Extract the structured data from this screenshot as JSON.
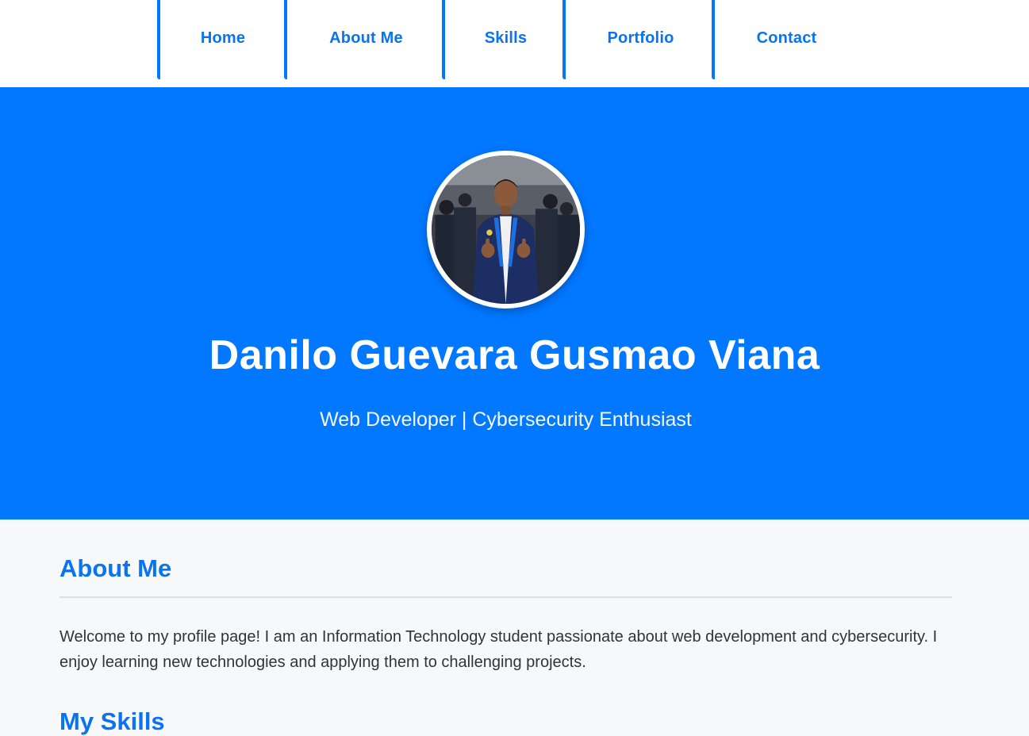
{
  "nav": {
    "items": [
      {
        "label": "Home"
      },
      {
        "label": "About Me"
      },
      {
        "label": "Skills"
      },
      {
        "label": "Portfolio"
      },
      {
        "label": "Contact"
      }
    ]
  },
  "hero": {
    "name": "Danilo Guevara Gusmao Viana",
    "tagline": "Web Developer | Cybersecurity Enthusiast"
  },
  "about": {
    "title": "About Me",
    "text": "Welcome to my profile page! I am an Information Technology student passionate about web development and cybersecurity. I enjoy learning new technologies and applying them to challenging projects."
  },
  "skills": {
    "title": "My Skills"
  },
  "colors": {
    "accent": "#0277ff",
    "link": "#0a73f0",
    "background": "#f7f8fa"
  }
}
